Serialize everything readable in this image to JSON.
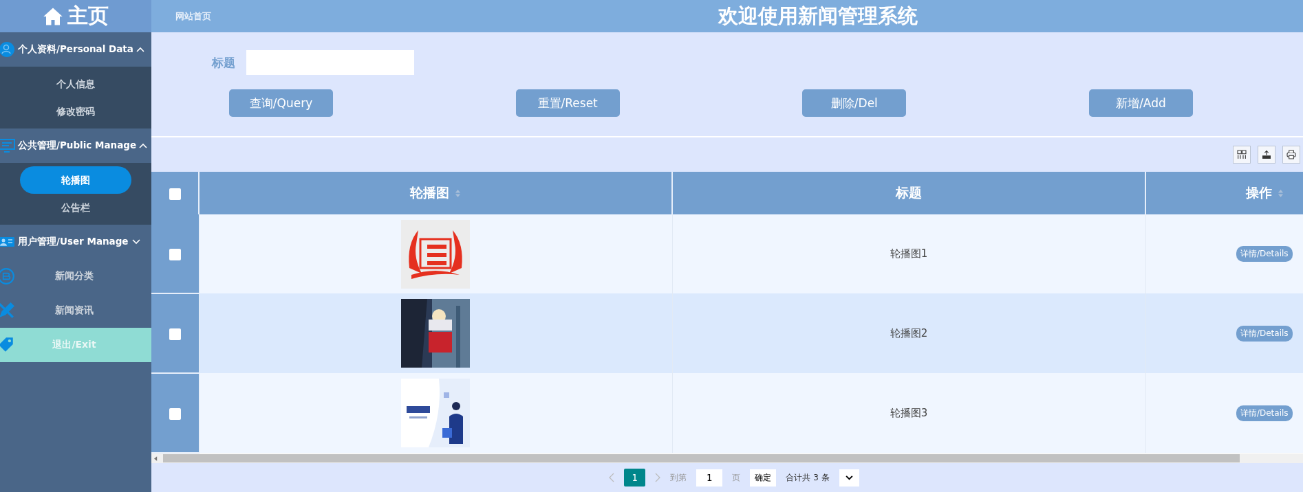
{
  "sidebar": {
    "title": "主页",
    "items": [
      {
        "kind": "group",
        "label": "个人资料/Personal Data",
        "expanded": true,
        "children": [
          {
            "label": "个人信息",
            "selected": false
          },
          {
            "label": "修改密码",
            "selected": false
          }
        ]
      },
      {
        "kind": "group",
        "label": "公共管理/Public Manage",
        "expanded": true,
        "children": [
          {
            "label": "轮播图",
            "selected": true
          },
          {
            "label": "公告栏",
            "selected": false
          }
        ]
      },
      {
        "kind": "group",
        "label": "用户管理/User Manage",
        "expanded": false
      },
      {
        "kind": "item",
        "label": "新闻分类"
      },
      {
        "kind": "item",
        "label": "新闻资讯"
      },
      {
        "kind": "exit",
        "label": "退出/Exit"
      }
    ]
  },
  "header": {
    "link": "网站首页",
    "title": "欢迎使用新闻管理系统"
  },
  "search": {
    "label": "标题",
    "buttons": [
      "查询/Query",
      "重置/Reset",
      "删除/Del",
      "新增/Add"
    ]
  },
  "table": {
    "all_checked": false,
    "columns": [
      {
        "label": "轮播图",
        "sortable": true
      },
      {
        "label": "标题",
        "sortable": false
      },
      {
        "label": "操作",
        "sortable": true
      }
    ],
    "rows": [
      {
        "checked": false,
        "title": "轮播图1",
        "action": "详情/Details"
      },
      {
        "checked": false,
        "title": "轮播图2",
        "action": "详情/Details"
      },
      {
        "checked": false,
        "title": "轮播图3",
        "action": "详情/Details"
      }
    ]
  },
  "pagination": {
    "pages": [
      {
        "label": "1",
        "selected": true
      }
    ],
    "goto_label": "到第",
    "goto_value": "1",
    "page_unit": "页",
    "confirm": "确定",
    "total": "合计共 3 条"
  }
}
